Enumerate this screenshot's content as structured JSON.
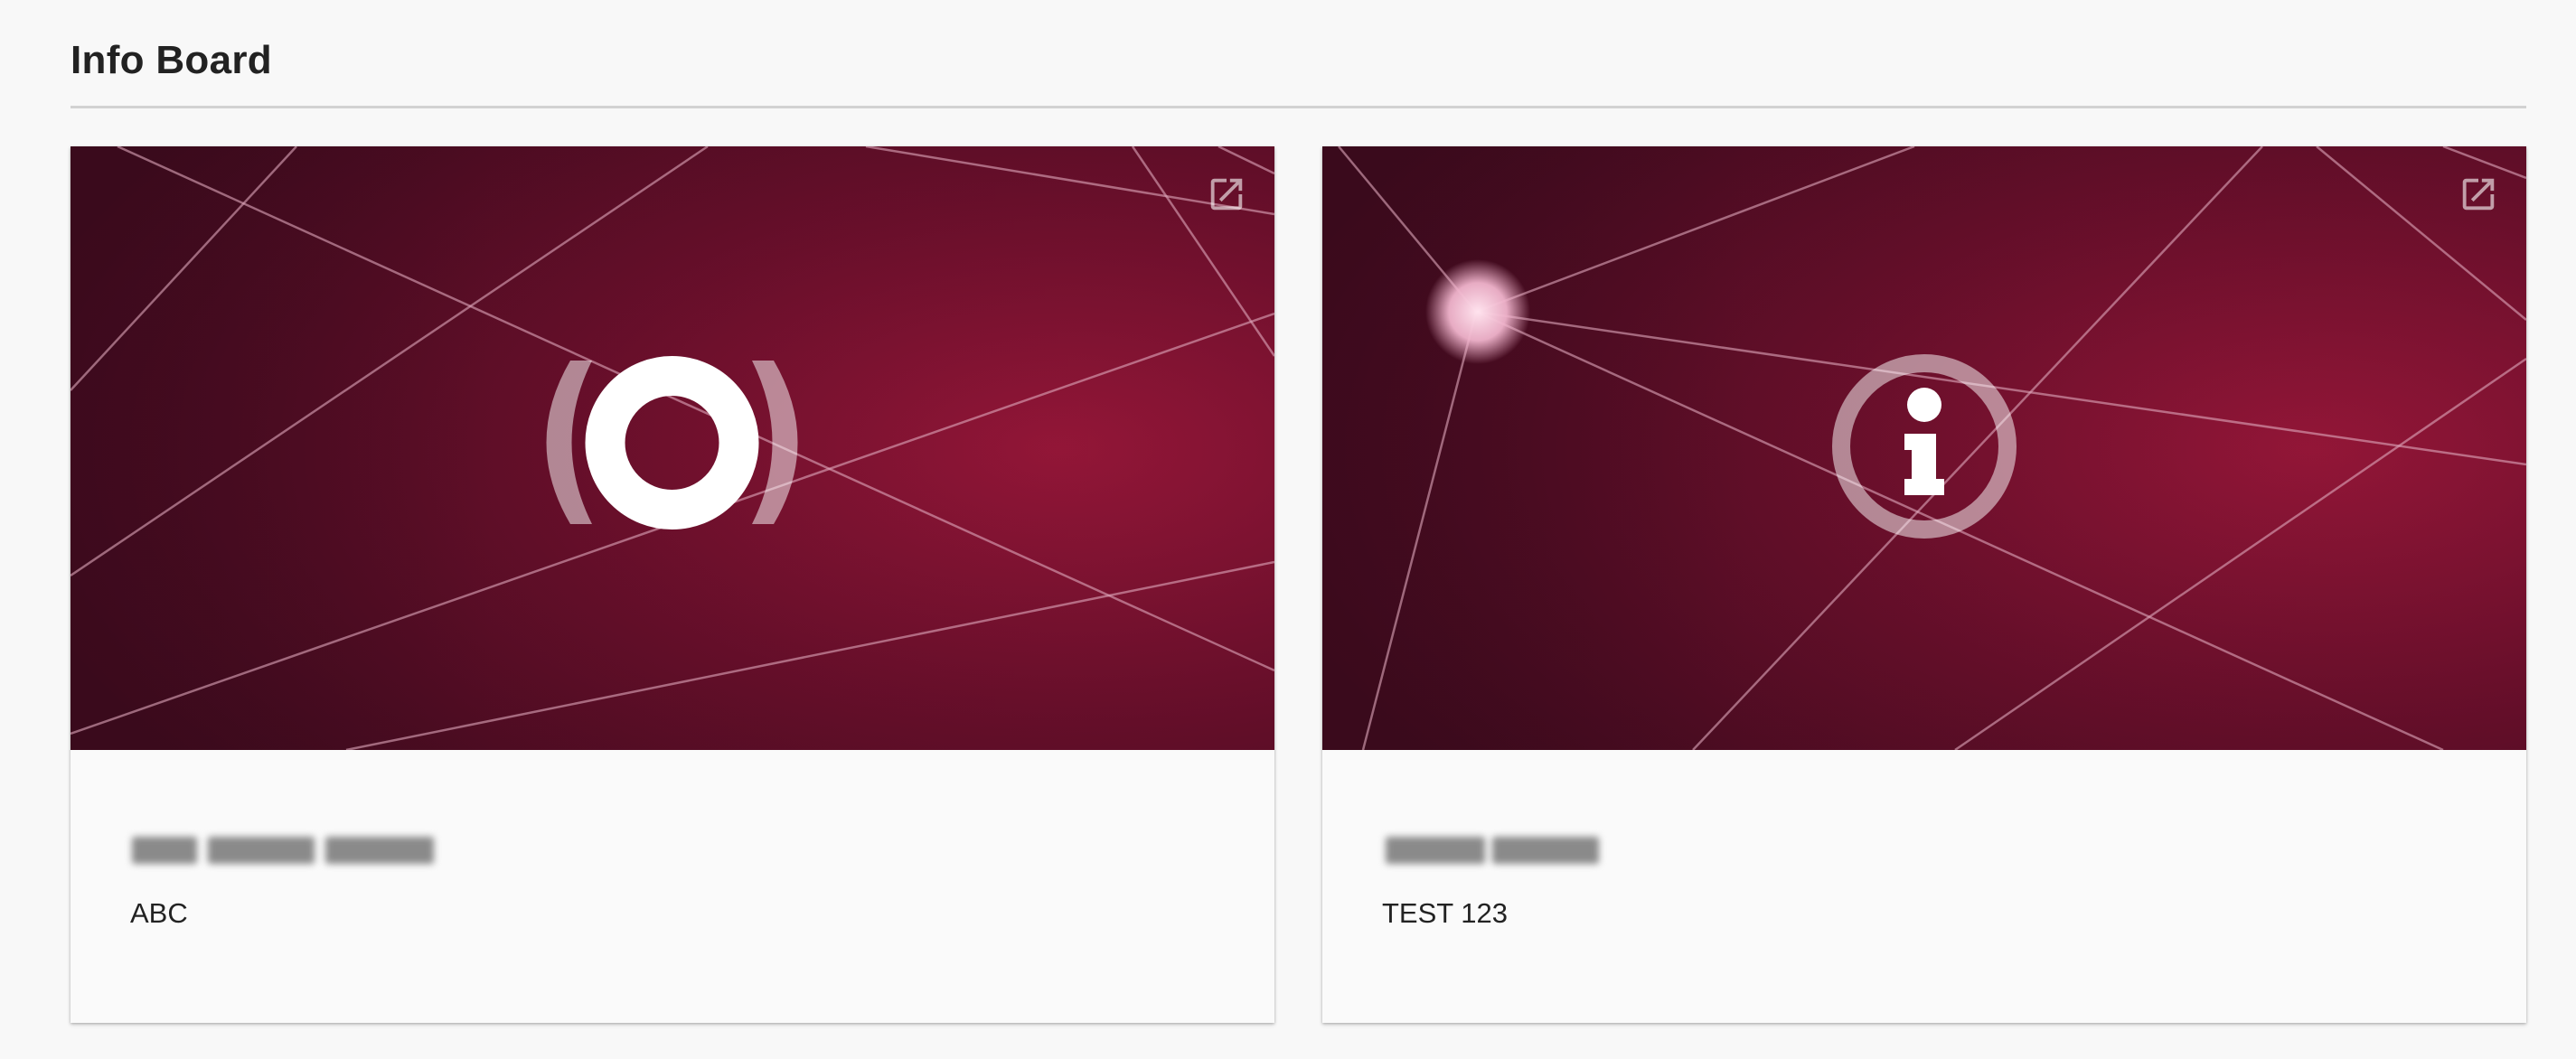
{
  "header": {
    "title": "Info Board"
  },
  "cards": [
    {
      "icon": "broadcast-icon",
      "description": "ABC",
      "open_icon": "open-external-icon"
    },
    {
      "icon": "info-circle-icon",
      "description": "TEST 123",
      "open_icon": "open-external-icon"
    }
  ],
  "colors": {
    "page_background": "#f8f8f8",
    "banner_dark": "#3d0a1e",
    "banner_accent": "#8e1537",
    "icon_white": "#ffffff",
    "text": "#222222"
  }
}
